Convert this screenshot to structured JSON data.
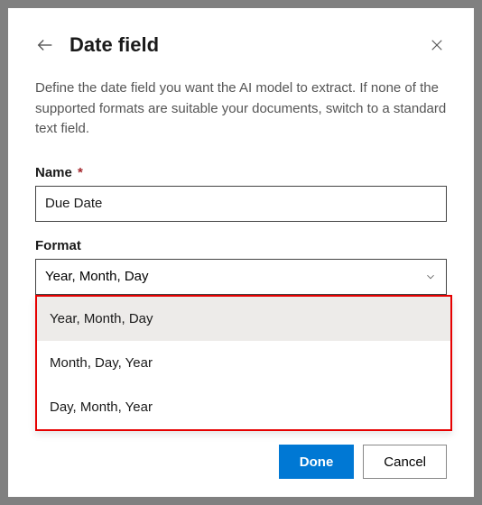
{
  "header": {
    "title": "Date field"
  },
  "description": "Define the date field you want the AI model to extract. If none of the supported formats are suitable your documents, switch to a standard text field.",
  "fields": {
    "name": {
      "label": "Name",
      "required_mark": "*",
      "value": "Due Date"
    },
    "format": {
      "label": "Format",
      "selected": "Year, Month, Day",
      "options": [
        "Year, Month, Day",
        "Month, Day, Year",
        "Day, Month, Year"
      ]
    }
  },
  "footer": {
    "done": "Done",
    "cancel": "Cancel"
  }
}
